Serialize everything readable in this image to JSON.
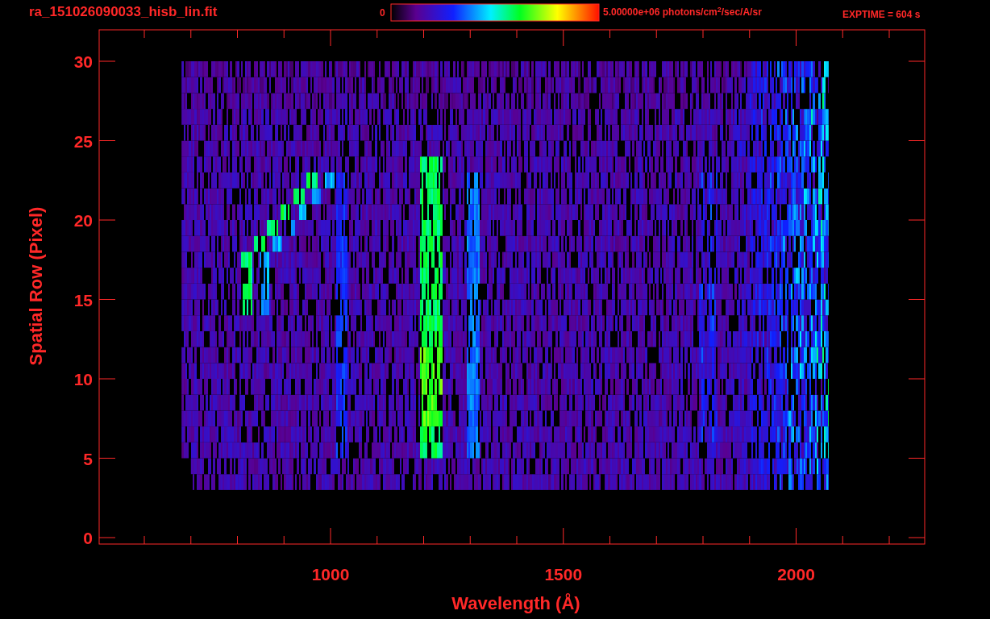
{
  "title": "ra_151026090033_hisb_lin.fit",
  "colorbar": {
    "min_label": "0",
    "max_label": "5.00000e+06 photons/cm$^{2}$/sec/A/sr"
  },
  "exposure": "EXPTIME = 604 s",
  "y_axis": {
    "label": "Spatial Row (Pixel)",
    "ticks": [
      "30",
      "25",
      "20",
      "15",
      "10",
      "5",
      "0"
    ]
  },
  "x_axis": {
    "label": "Wavelength (Å)",
    "ticks": [
      "1000",
      "1500",
      "2000"
    ]
  }
}
